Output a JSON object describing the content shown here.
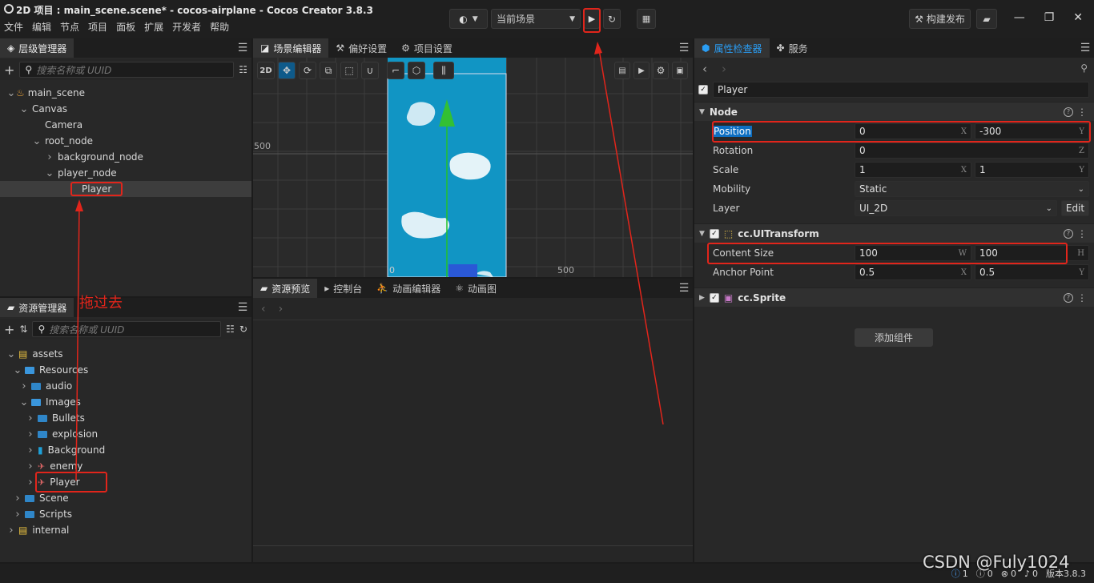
{
  "window": {
    "title": "2D 项目 : main_scene.scene* - cocos-airplane - Cocos Creator 3.8.3",
    "menu": [
      "文件",
      "编辑",
      "节点",
      "项目",
      "面板",
      "扩展",
      "开发者",
      "帮助"
    ],
    "scene_select": "当前场景",
    "build_label": "构建发布"
  },
  "hierarchy": {
    "tab": "层级管理器",
    "search_placeholder": "搜索名称或 UUID",
    "nodes": [
      {
        "label": "main_scene",
        "depth": 0,
        "caret": "v"
      },
      {
        "label": "Canvas",
        "depth": 1,
        "caret": "v"
      },
      {
        "label": "Camera",
        "depth": 2,
        "caret": ""
      },
      {
        "label": "root_node",
        "depth": 2,
        "caret": "v"
      },
      {
        "label": "background_node",
        "depth": 3,
        "caret": ">"
      },
      {
        "label": "player_node",
        "depth": 3,
        "caret": "v"
      },
      {
        "label": "Player",
        "depth": 4,
        "caret": ""
      }
    ]
  },
  "assets": {
    "tab": "资源管理器",
    "search_placeholder": "搜索名称或 UUID",
    "items": [
      {
        "label": "assets",
        "depth": 0,
        "caret": "v",
        "icon": "db-icon"
      },
      {
        "label": "Resources",
        "depth": 1,
        "caret": "v",
        "icon": "folder-open-icon"
      },
      {
        "label": "audio",
        "depth": 2,
        "caret": ">",
        "icon": "folder-icon"
      },
      {
        "label": "Images",
        "depth": 2,
        "caret": "v",
        "icon": "folder-open-icon"
      },
      {
        "label": "Bullets",
        "depth": 3,
        "caret": ">",
        "icon": "folder-icon"
      },
      {
        "label": "explosion",
        "depth": 3,
        "caret": ">",
        "icon": "folder-icon"
      },
      {
        "label": "Background",
        "depth": 3,
        "caret": ">",
        "icon": "image-icon"
      },
      {
        "label": "enemy",
        "depth": 3,
        "caret": ">",
        "icon": "plane-icon"
      },
      {
        "label": "Player",
        "depth": 3,
        "caret": ">",
        "icon": "plane-icon"
      },
      {
        "label": "Scene",
        "depth": 1,
        "caret": ">",
        "icon": "folder-icon"
      },
      {
        "label": "Scripts",
        "depth": 1,
        "caret": ">",
        "icon": "folder-icon"
      },
      {
        "label": "internal",
        "depth": 0,
        "caret": ">",
        "icon": "db-icon"
      }
    ]
  },
  "annotation_drag": "拖过去",
  "scene_editor": {
    "tabs": [
      "场景编辑器",
      "偏好设置",
      "项目设置"
    ],
    "mode_label": "2D",
    "tick_left": "500",
    "tick_bottom_left": "0",
    "tick_bottom_right": "500"
  },
  "bottom_panel": {
    "tabs": [
      "资源预览",
      "控制台",
      "动画编辑器",
      "动画图"
    ]
  },
  "inspector": {
    "tabs": [
      "属性检查器",
      "服务"
    ],
    "node_name": "Player",
    "node_section": "Node",
    "position": {
      "label": "Position",
      "x": "0",
      "y": "-300"
    },
    "rotation": {
      "label": "Rotation",
      "z": "0"
    },
    "scale": {
      "label": "Scale",
      "x": "1",
      "y": "1"
    },
    "mobility": {
      "label": "Mobility",
      "value": "Static"
    },
    "layer": {
      "label": "Layer",
      "value": "UI_2D",
      "edit": "Edit"
    },
    "uitransform": {
      "title": "cc.UITransform",
      "content_size_label": "Content Size",
      "w": "100",
      "h": "100",
      "anchor_label": "Anchor Point",
      "ax": "0.5",
      "ay": "0.5"
    },
    "sprite": {
      "title": "cc.Sprite"
    },
    "add_component": "添加组件",
    "axis": {
      "x": "X",
      "y": "Y",
      "z": "Z",
      "w": "W",
      "h": "H"
    }
  },
  "statusbar": {
    "info": "1",
    "warn": "0",
    "error": "0",
    "notice": "0",
    "version": "版本3.8.3"
  },
  "watermark": "CSDN @Fuly1024",
  "colors": {
    "accent": "#0e75bf",
    "annotation": "#e1251b",
    "scene_bg": "#1195c4"
  }
}
